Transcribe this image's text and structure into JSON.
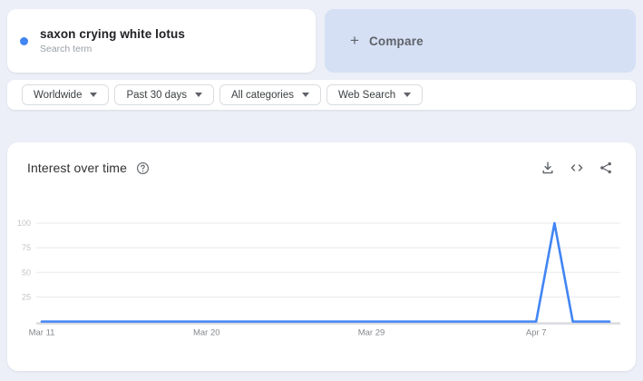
{
  "term_card": {
    "title": "saxon crying white lotus",
    "subtitle": "Search term",
    "dot_color": "#4285f4"
  },
  "compare_card": {
    "plus": "+",
    "label": "Compare"
  },
  "filters": {
    "items": [
      {
        "label": "Worldwide"
      },
      {
        "label": "Past 30 days"
      },
      {
        "label": "All categories"
      },
      {
        "label": "Web Search"
      }
    ]
  },
  "chart_section": {
    "title": "Interest over time",
    "help_icon": "question-mark-circle",
    "actions": [
      {
        "name": "download-icon"
      },
      {
        "name": "embed-icon"
      },
      {
        "name": "share-icon"
      }
    ]
  },
  "colors": {
    "accent_blue": "#4285f4",
    "page_background": "#ecEFF7",
    "compare_background": "#d5e0f5",
    "grid_line": "#e9eaee",
    "axis_line": "#dadce0",
    "icon_gray": "#5f6368"
  },
  "chart_data": {
    "type": "line",
    "title": "Interest over time",
    "series_name": "saxon crying white lotus",
    "categories": [
      "Mar 11",
      "Mar 12",
      "Mar 13",
      "Mar 14",
      "Mar 15",
      "Mar 16",
      "Mar 17",
      "Mar 18",
      "Mar 19",
      "Mar 20",
      "Mar 21",
      "Mar 22",
      "Mar 23",
      "Mar 24",
      "Mar 25",
      "Mar 26",
      "Mar 27",
      "Mar 28",
      "Mar 29",
      "Mar 30",
      "Mar 31",
      "Apr 1",
      "Apr 2",
      "Apr 3",
      "Apr 4",
      "Apr 5",
      "Apr 6",
      "Apr 7",
      "Apr 8",
      "Apr 9",
      "Apr 10",
      "Apr 11"
    ],
    "values": [
      0,
      0,
      0,
      0,
      0,
      0,
      0,
      0,
      0,
      0,
      0,
      0,
      0,
      0,
      0,
      0,
      0,
      0,
      0,
      0,
      0,
      0,
      0,
      0,
      0,
      0,
      0,
      0,
      100,
      0,
      0,
      0
    ],
    "x_tick_indices": [
      0,
      9,
      18,
      27
    ],
    "yticks": [
      25,
      50,
      75,
      100
    ],
    "ylim": [
      0,
      100
    ],
    "line_color": "#4285f4",
    "grid": true,
    "legend": "none"
  }
}
